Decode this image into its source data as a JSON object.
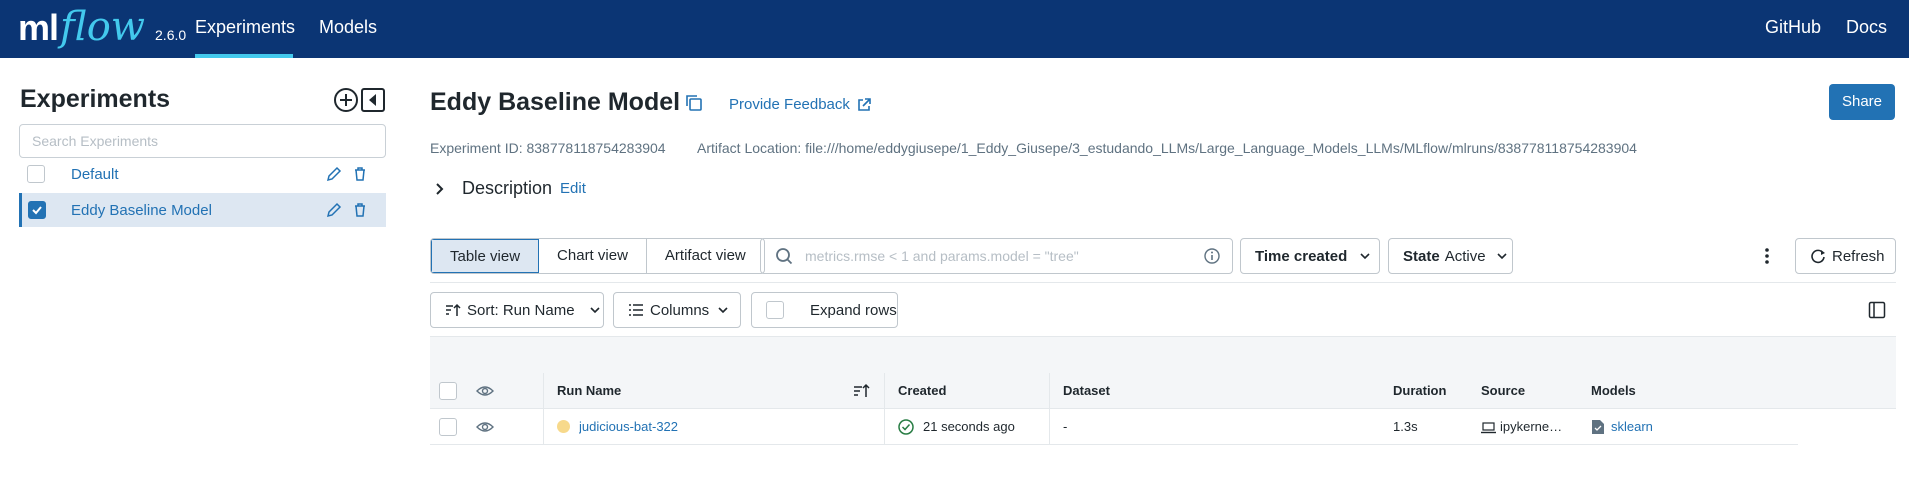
{
  "header": {
    "logo_ml": "ml",
    "logo_flow": "flow",
    "version": "2.6.0",
    "nav": [
      "Experiments",
      "Models"
    ],
    "right_links": [
      "GitHub",
      "Docs"
    ]
  },
  "sidebar": {
    "title": "Experiments",
    "search_placeholder": "Search Experiments",
    "experiments": [
      {
        "name": "Default",
        "checked": false
      },
      {
        "name": "Eddy Baseline Model",
        "checked": true
      }
    ]
  },
  "experiment": {
    "name": "Eddy Baseline Model",
    "feedback_label": "Provide Feedback",
    "share_label": "Share",
    "id_text": "Experiment ID: 838778118754283904",
    "artifact_text": "Artifact Location: file:///home/eddygiusepe/1_Eddy_Giusepe/3_estudando_LLMs/Large_Language_Models_LLMs/MLflow/mlruns/838778118754283904",
    "description_label": "Description",
    "description_edit": "Edit"
  },
  "toolbar": {
    "views": [
      "Table view",
      "Chart view",
      "Artifact view"
    ],
    "filter_placeholder": "metrics.rmse < 1 and params.model = \"tree\"",
    "time_created": "Time created",
    "state_label": "State",
    "state_value": "Active",
    "refresh_label": "Refresh",
    "sort_label": "Sort: Run Name",
    "columns_label": "Columns",
    "expand_label": "Expand rows"
  },
  "table": {
    "columns": [
      "Run Name",
      "Created",
      "Dataset",
      "Duration",
      "Source",
      "Models"
    ],
    "rows": [
      {
        "run_name": "judicious-bat-322",
        "created": "21 seconds ago",
        "dataset": "-",
        "duration": "1.3s",
        "source": "ipykerne…",
        "models": "sklearn"
      }
    ]
  },
  "colors": {
    "header_bg": "#0b3574",
    "accent": "#43c9ed",
    "primary": "#2272b4",
    "run_status": "#f7d98b",
    "success": "#277c43"
  }
}
